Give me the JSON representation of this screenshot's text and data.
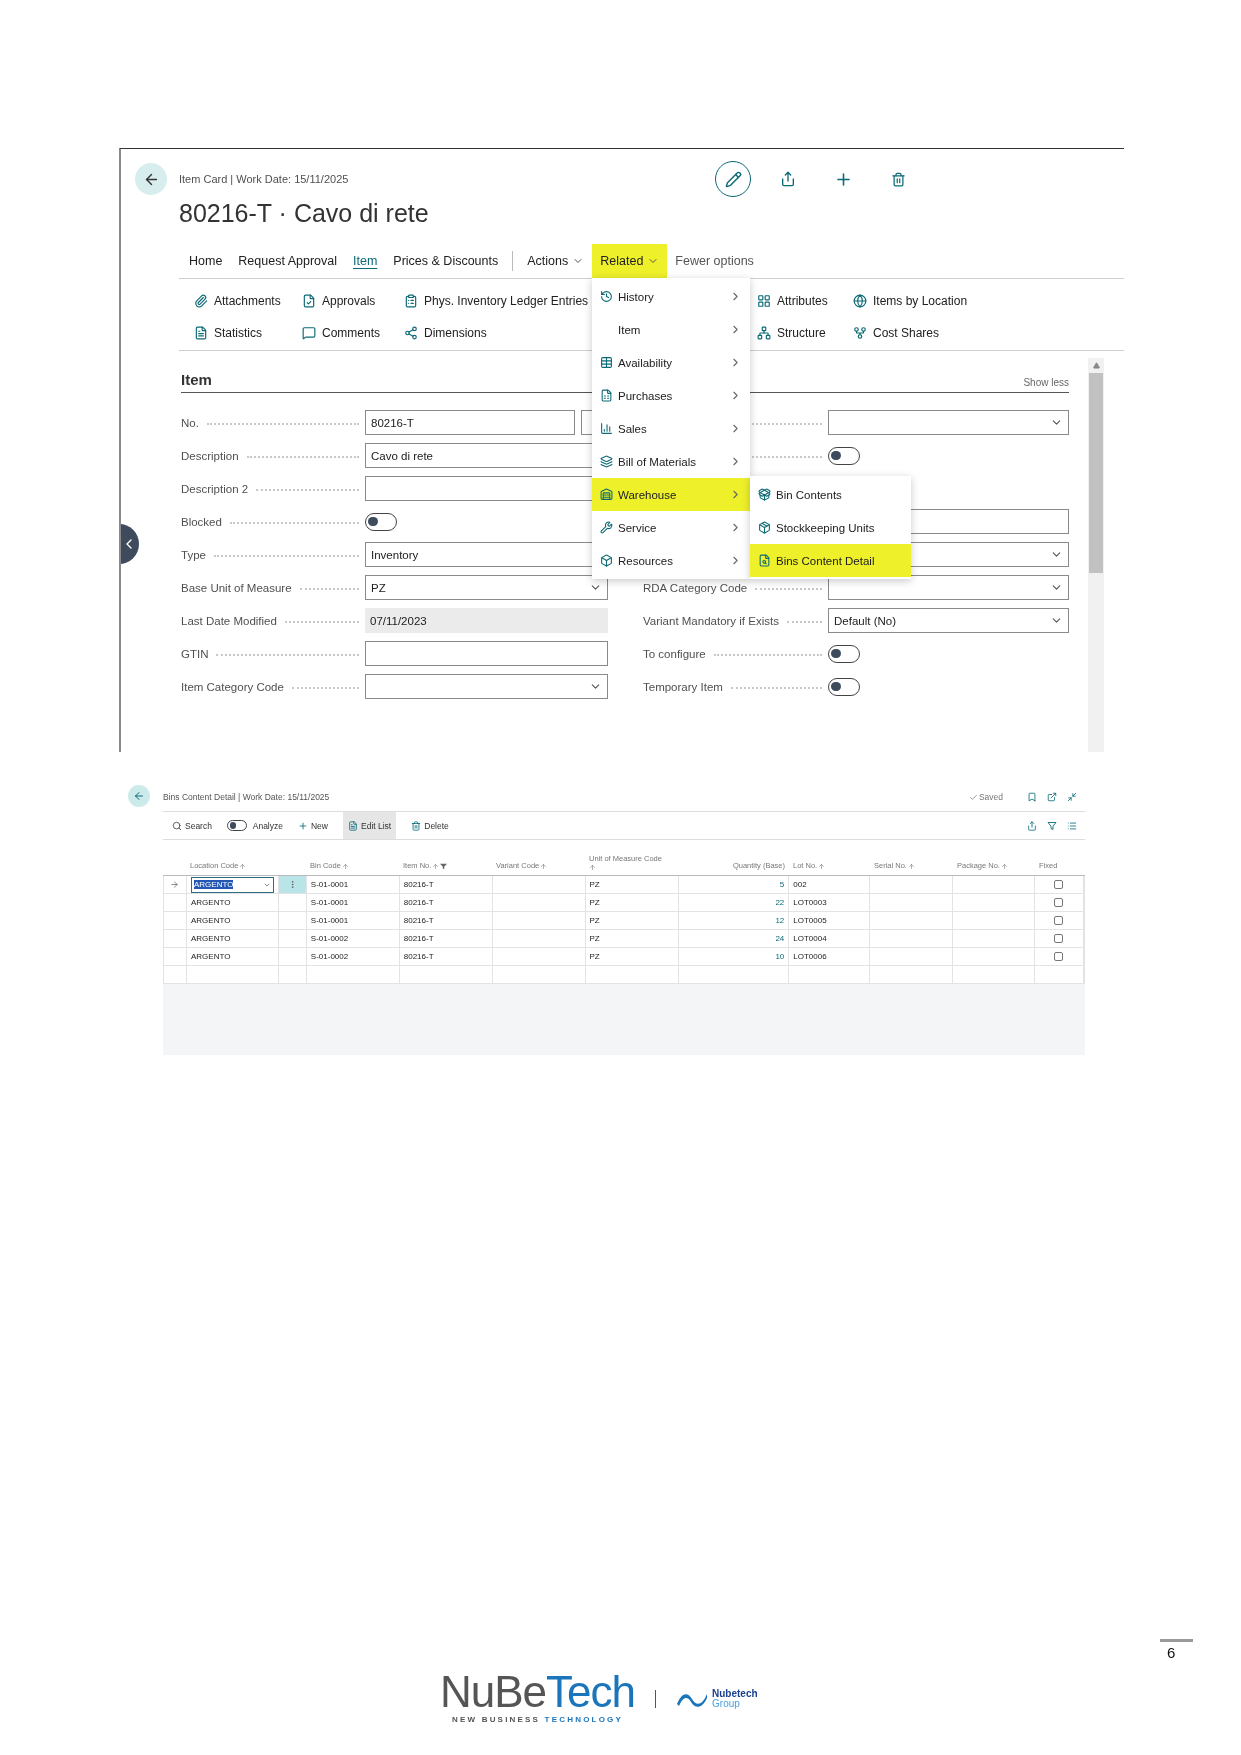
{
  "item_card": {
    "breadcrumb": "Item Card | Work Date: 15/11/2025",
    "title": "80216-T · Cavo di rete",
    "tabs": [
      {
        "label": "Home",
        "kind": "tab",
        "selected": false
      },
      {
        "label": "Request Approval",
        "kind": "tab",
        "selected": false
      },
      {
        "label": "Item",
        "kind": "tab",
        "selected": true
      },
      {
        "label": "Prices & Discounts",
        "kind": "tab",
        "selected": false
      },
      {
        "label": "Actions",
        "kind": "menu",
        "selected": false,
        "highlighted": false
      },
      {
        "label": "Related",
        "kind": "menu",
        "selected": false,
        "highlighted": true
      },
      {
        "label": "Fewer options",
        "kind": "link",
        "selected": false
      }
    ],
    "actions": [
      "Attachments",
      "Approvals",
      "Phys. Inventory Ledger Entries",
      "Attributes",
      "Items by Location",
      "Statistics",
      "Comments",
      "Dimensions",
      "Structure",
      "Cost Shares"
    ],
    "section": {
      "title": "Item",
      "toggle": "Show less"
    },
    "left_fields": [
      {
        "label": "No.",
        "kind": "lookup",
        "value": "80216-T"
      },
      {
        "label": "Description",
        "kind": "text",
        "value": "Cavo di rete"
      },
      {
        "label": "Description 2",
        "kind": "text"
      },
      {
        "label": "Blocked",
        "kind": "toggle",
        "on": false
      },
      {
        "label": "Type",
        "kind": "text",
        "value": "Inventory"
      },
      {
        "label": "Base Unit of Measure",
        "kind": "dropdown",
        "value": "PZ"
      },
      {
        "label": "Last Date Modified",
        "kind": "readonly",
        "value": "07/11/2023"
      },
      {
        "label": "GTIN",
        "kind": "text"
      },
      {
        "label": "Item Category Code",
        "kind": "dropdown"
      }
    ],
    "right_fields_upper": [
      {
        "kind": "dropdown"
      },
      {
        "kind": "toggle",
        "on": false
      }
    ],
    "right_fields": [
      {
        "kind": "text"
      },
      {
        "kind": "dropdown"
      },
      {
        "label": "RDA Category Code",
        "kind": "dropdown"
      },
      {
        "label": "Variant Mandatory if Exists",
        "kind": "dropdown",
        "value": "Default (No)"
      },
      {
        "label": "To configure",
        "kind": "toggle",
        "on": false
      },
      {
        "label": "Temporary Item",
        "kind": "toggle",
        "on": false
      }
    ],
    "related_menu": [
      {
        "label": "History",
        "highlighted": false
      },
      {
        "label": "Item",
        "highlighted": false
      },
      {
        "label": "Availability",
        "highlighted": false
      },
      {
        "label": "Purchases",
        "highlighted": false
      },
      {
        "label": "Sales",
        "highlighted": false
      },
      {
        "label": "Bill of Materials",
        "highlighted": false
      },
      {
        "label": "Warehouse",
        "highlighted": true
      },
      {
        "label": "Service",
        "highlighted": false
      },
      {
        "label": "Resources",
        "highlighted": false
      }
    ],
    "warehouse_submenu": [
      {
        "label": "Bin Contents",
        "highlighted": false
      },
      {
        "label": "Stockkeeping Units",
        "highlighted": false
      },
      {
        "label": "Bins Content Detail",
        "highlighted": true
      }
    ]
  },
  "bins_content_detail": {
    "breadcrumb": "Bins Content Detail | Work Date: 15/11/2025",
    "status": "Saved",
    "toolbar": [
      {
        "label": "Search",
        "kind": "search",
        "selected": false
      },
      {
        "label": "Analyze",
        "kind": "toggle",
        "on": false
      },
      {
        "label": "New",
        "kind": "new",
        "selected": false
      },
      {
        "label": "Edit List",
        "kind": "edit",
        "selected": true
      },
      {
        "label": "Delete",
        "kind": "delete",
        "selected": false
      }
    ],
    "columns": [
      {
        "label": "Location Code",
        "sorted": true,
        "filtered": false
      },
      {
        "label": "Bin Code",
        "sorted": true,
        "filtered": false
      },
      {
        "label": "Item No.",
        "sorted": true,
        "filtered": true
      },
      {
        "label": "Variant Code",
        "sorted": true,
        "filtered": false
      },
      {
        "label": "Unit of Measure Code",
        "sorted": true,
        "filtered": false
      },
      {
        "label": "Quantity (Base)",
        "sorted": false,
        "filtered": false
      },
      {
        "label": "Lot No.",
        "sorted": true,
        "filtered": false
      },
      {
        "label": "Serial No.",
        "sorted": true,
        "filtered": false
      },
      {
        "label": "Package No.",
        "sorted": true,
        "filtered": false
      },
      {
        "label": "Fixed",
        "sorted": false,
        "filtered": false
      }
    ],
    "rows": [
      {
        "selected": true,
        "location_code": "ARGENTO",
        "bin_code": "S-01-0001",
        "item_no": "80216-T",
        "unit_of_measure_code": "PZ",
        "quantity_base": "5",
        "lot_no": "002",
        "fixed": false
      },
      {
        "selected": false,
        "location_code": "ARGENTO",
        "bin_code": "S-01-0001",
        "item_no": "80216-T",
        "unit_of_measure_code": "PZ",
        "quantity_base": "22",
        "lot_no": "LOT0003",
        "fixed": false
      },
      {
        "selected": false,
        "location_code": "ARGENTO",
        "bin_code": "S-01-0001",
        "item_no": "80216-T",
        "unit_of_measure_code": "PZ",
        "quantity_base": "12",
        "lot_no": "LOT0005",
        "fixed": false
      },
      {
        "selected": false,
        "location_code": "ARGENTO",
        "bin_code": "S-01-0002",
        "item_no": "80216-T",
        "unit_of_measure_code": "PZ",
        "quantity_base": "24",
        "lot_no": "LOT0004",
        "fixed": false
      },
      {
        "selected": false,
        "location_code": "ARGENTO",
        "bin_code": "S-01-0002",
        "item_no": "80216-T",
        "unit_of_measure_code": "PZ",
        "quantity_base": "10",
        "lot_no": "LOT0006",
        "fixed": false
      }
    ]
  },
  "footer": {
    "page_number": "6",
    "logo_wordmark": [
      "NuBe",
      "Tech"
    ],
    "logo_tagline": [
      "NEW BUSINESS",
      "TECHNOLOGY"
    ],
    "group_name": "Nubetech",
    "group_subtitle": "Group"
  }
}
